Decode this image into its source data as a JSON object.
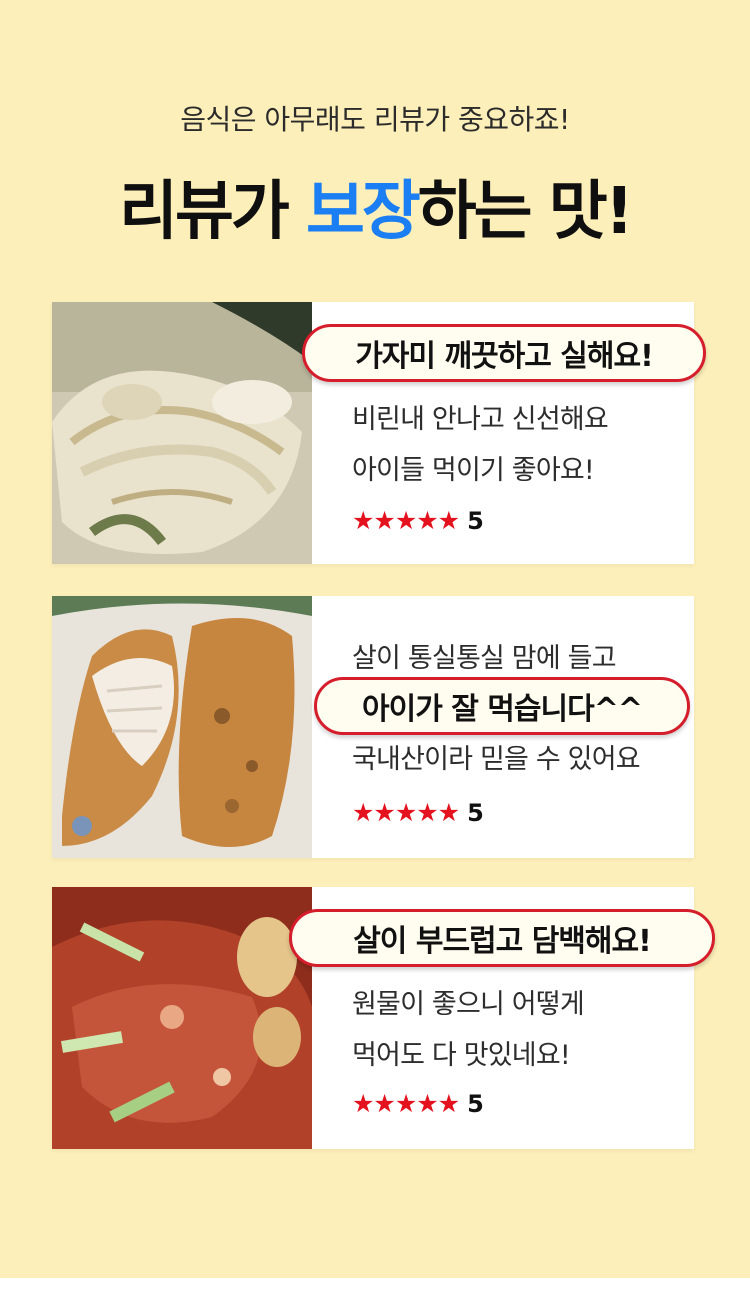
{
  "header": {
    "subtitle": "음식은 아무래도 리뷰가 중요하죠!",
    "title_part1": "리뷰가 ",
    "title_highlight": "보장",
    "title_part2": "하는 맛!"
  },
  "colors": {
    "background": "#fdefb9",
    "highlight": "#1b7ef2",
    "bubble_border": "#d51d2b",
    "stars": "#e4111e"
  },
  "reviews": [
    {
      "headline": "가자미 깨끗하고 실해요!",
      "lines": [
        "비린내 안나고 신선해요",
        "아이들 먹이기 좋아요!"
      ],
      "stars": "★★★★★",
      "rating": 5,
      "rating_label": "5",
      "photo_icon": "grilled-flounder-photo"
    },
    {
      "headline": "아이가 잘 먹습니다^^",
      "lines": [
        "살이 통실통실 맘에 들고",
        "국내산이라 믿을 수 있어요"
      ],
      "stars": "★★★★★",
      "rating": 5,
      "rating_label": "5",
      "photo_icon": "fried-flounder-photo"
    },
    {
      "headline": "살이 부드럽고 담백해요!",
      "lines": [
        "원물이 좋으니 어떻게",
        "먹어도 다 맛있네요!"
      ],
      "stars": "★★★★★",
      "rating": 5,
      "rating_label": "5",
      "photo_icon": "braised-flounder-photo"
    }
  ]
}
